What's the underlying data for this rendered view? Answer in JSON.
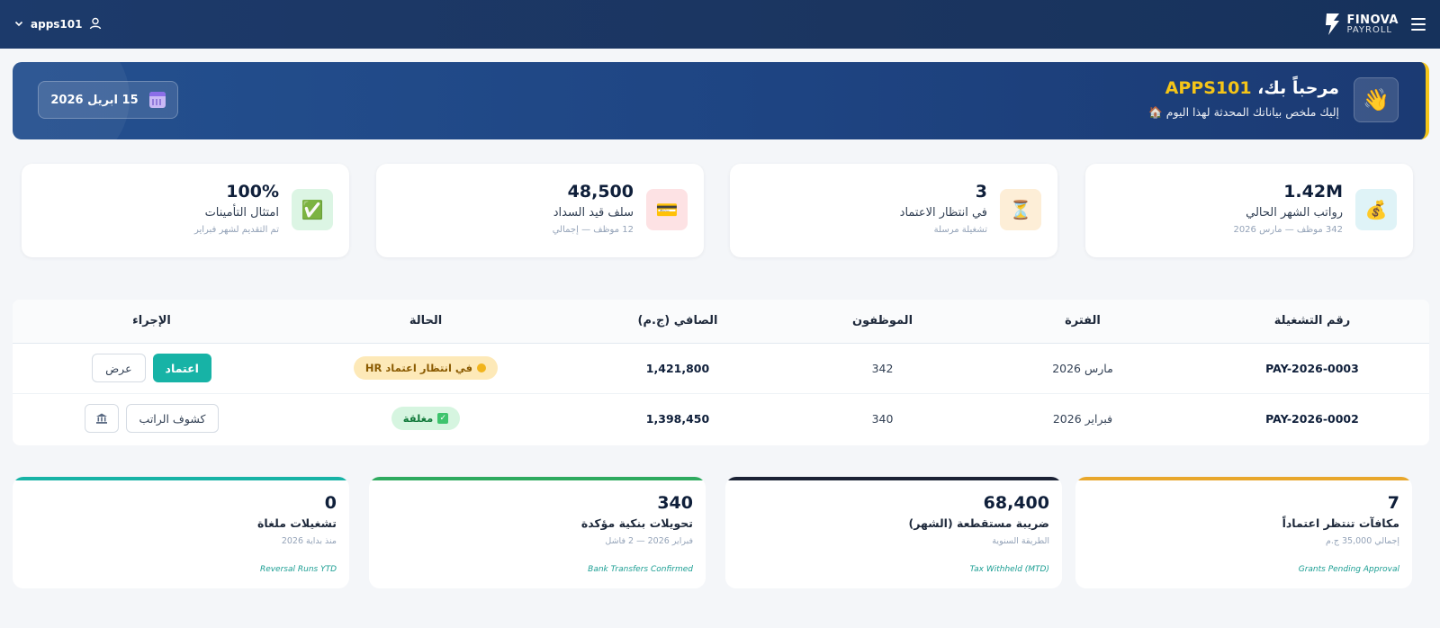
{
  "topbar": {
    "username": "apps101",
    "logo_line1": "FINOVA",
    "logo_line2": "PAYROLL",
    "colors": {
      "background": "#1b3560"
    }
  },
  "welcome": {
    "greeting": "مرحباً بك، ",
    "username": "APPS101",
    "subtitle": "إليك ملخص بياناتك المحدثة لهذا اليوم 🏠",
    "date": "15 ابريل 2026",
    "wave_icon": "👋"
  },
  "stats": [
    {
      "value": "1.42M",
      "label": "رواتب الشهر الحالي",
      "sub": "342 موظف — مارس 2026",
      "icon": "💰",
      "icon_bg": "#dff3f7"
    },
    {
      "value": "3",
      "label": "في انتظار الاعتماد",
      "sub": "تشغيلة مرسلة",
      "icon": "⏳",
      "icon_bg": "#fdeed7"
    },
    {
      "value": "48,500",
      "label": "سلف قيد السداد",
      "sub": "12 موظف — إجمالي",
      "icon": "💳",
      "icon_bg": "#fde2e4"
    },
    {
      "value": "100%",
      "label": "امتثال التأمينات",
      "sub": "تم التقديم لشهر فبراير",
      "icon": "✅",
      "icon_bg": "#dcf5e4"
    }
  ],
  "table": {
    "headers": [
      "رقم التشغيلة",
      "الفترة",
      "الموظفون",
      "الصافي (ج.م)",
      "الحالة",
      "الإجراء"
    ],
    "rows": [
      {
        "run_id": "PAY-2026-0003",
        "period": "مارس 2026",
        "employees": "342",
        "net": "1,421,800",
        "status": "في انتظار اعتماد HR",
        "btn_approve": "اعتماد",
        "btn_view": "عرض"
      },
      {
        "run_id": "PAY-2026-0002",
        "period": "فبراير 2026",
        "employees": "340",
        "net": "1,398,450",
        "status": "مغلقة",
        "btn_payslips": "كشوف الراتب"
      }
    ]
  },
  "kpis": [
    {
      "value": "7",
      "label": "مكافآت تنتظر اعتماداً",
      "sub": "إجمالي 35,000 ج.م",
      "en": "Grants Pending Approval",
      "color": "#e8a72c"
    },
    {
      "value": "68,400",
      "label": "ضريبة مستقطعة (الشهر)",
      "sub": "الطريقة السنوية",
      "en": "Tax Withheld (MTD)",
      "color": "#1b2235"
    },
    {
      "value": "340",
      "label": "تحويلات بنكية مؤكدة",
      "sub": "فبراير 2026 — 2 فاشل",
      "en": "Bank Transfers Confirmed",
      "color": "#2eaa5f"
    },
    {
      "value": "0",
      "label": "تشغيلات ملغاة",
      "sub": "منذ بداية 2026",
      "en": "Reversal Runs YTD",
      "color": "#17b3a6"
    }
  ]
}
